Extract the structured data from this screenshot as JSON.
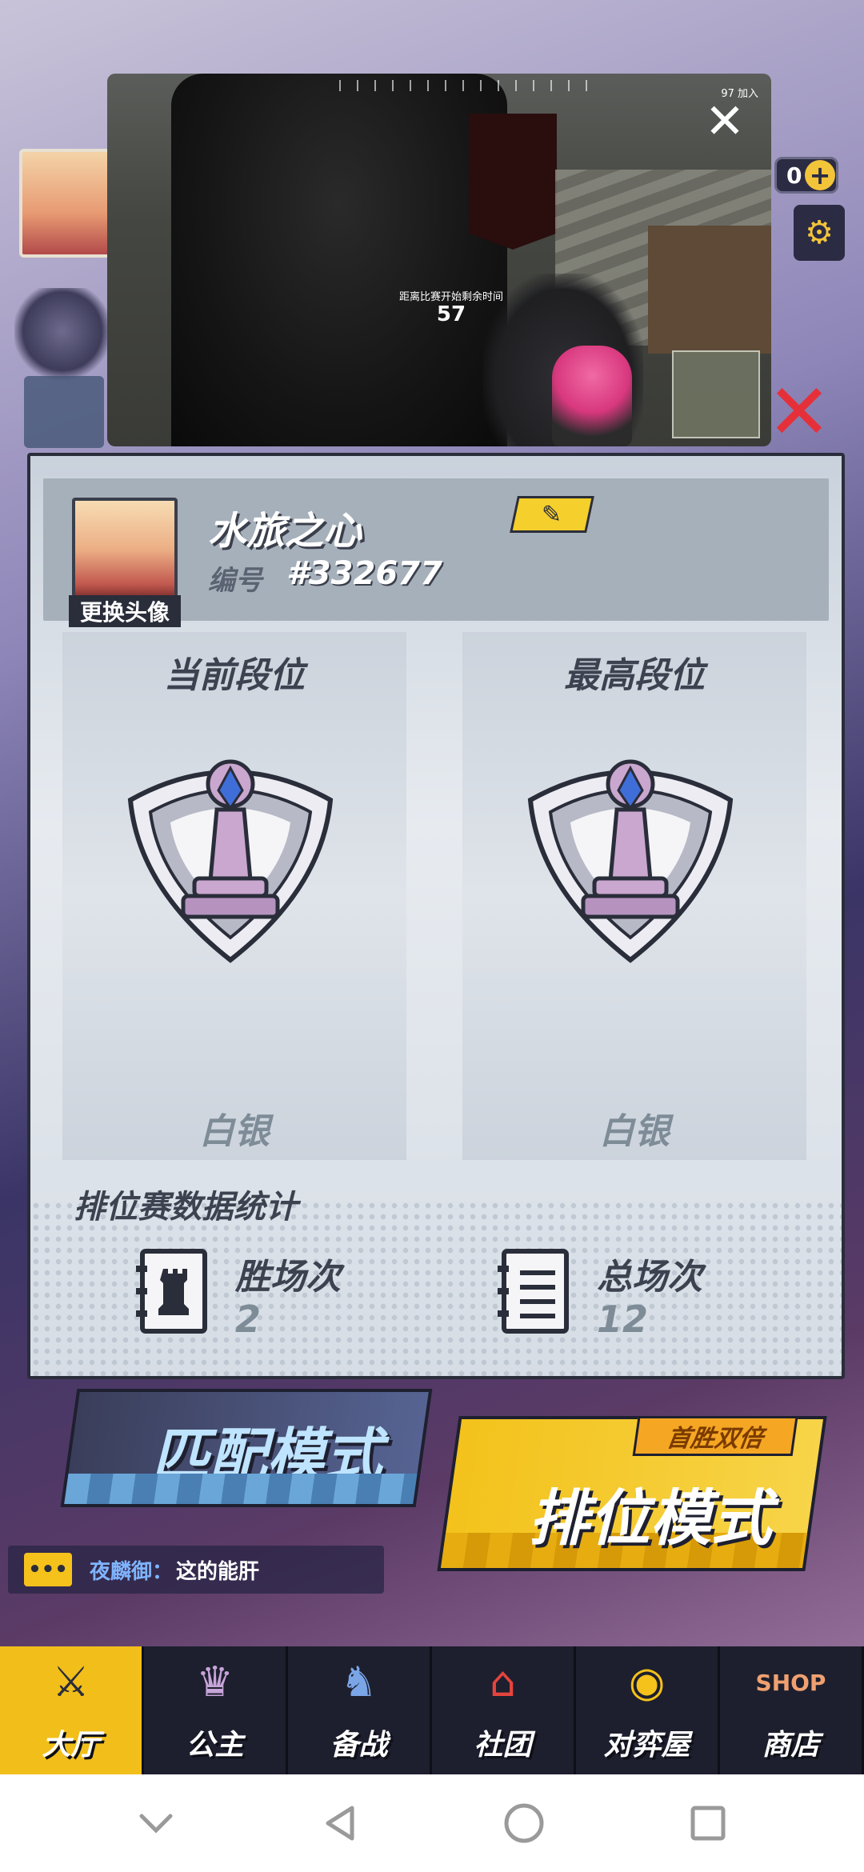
{
  "video_overlay": {
    "countdown_label": "距离比赛开始剩余时间",
    "countdown_value": "57",
    "alive_text": "97 加入"
  },
  "background": {
    "coins_value": "0"
  },
  "profile": {
    "name": "水旅之心",
    "id_label": "编号",
    "id_value": "#332677",
    "avatar_label": "更换头像"
  },
  "ranks": {
    "current": {
      "title": "当前段位",
      "name": "白银"
    },
    "highest": {
      "title": "最高段位",
      "name": "白银"
    }
  },
  "stats": {
    "title": "排位赛数据统计",
    "wins_label": "胜场次",
    "wins_value": "2",
    "total_label": "总场次",
    "total_value": "12"
  },
  "modes": {
    "match": "匹配模式",
    "rank": "排位模式",
    "rank_ribbon": "首胜双倍"
  },
  "chat": {
    "sender": "夜麟御：",
    "message": "这的能肝"
  },
  "bottom_nav": [
    {
      "label": "大厅",
      "icon": "sword-shield-icon",
      "active": true
    },
    {
      "label": "公主",
      "icon": "princess-icon",
      "active": false
    },
    {
      "label": "备战",
      "icon": "chess-pieces-icon",
      "active": false
    },
    {
      "label": "社团",
      "icon": "guild-house-icon",
      "active": false
    },
    {
      "label": "对弈屋",
      "icon": "crystal-ball-icon",
      "active": false
    },
    {
      "label": "商店",
      "icon": "shop-icon",
      "active": false
    }
  ],
  "colors": {
    "accent_yellow": "#f2bf1a",
    "dialog_border": "#2a2d3a",
    "rank_text": "#7e8c98"
  }
}
